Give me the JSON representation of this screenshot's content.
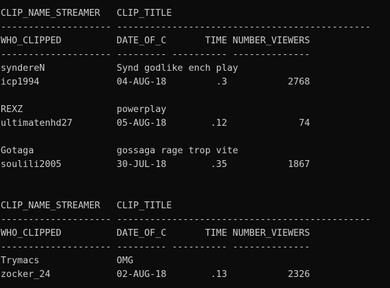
{
  "colors": {
    "background": "#0c0c0c",
    "text": "#cccccc"
  },
  "console": {
    "lines": [
      "CLIP_NAME_STREAMER   CLIP_TITLE",
      "-------------------- ----------------------------------------------",
      "WHO_CLIPPED          DATE_OF_C       TIME NUMBER_VIEWERS",
      "-------------------- --------- ---------- --------------",
      "syndereN             Synd godlike ench play",
      "icp1994              04-AUG-18         .3           2768",
      "",
      "REXZ                 powerplay",
      "ultimatenhd27        05-AUG-18        .12             74",
      "",
      "Gotaga               gossaga rage trop vite",
      "soulili2005          30-JUL-18        .35           1867",
      "",
      "",
      "CLIP_NAME_STREAMER   CLIP_TITLE",
      "-------------------- ----------------------------------------------",
      "WHO_CLIPPED          DATE_OF_C       TIME NUMBER_VIEWERS",
      "-------------------- --------- ---------- --------------",
      "Trymacs              OMG",
      "zocker_24            02-AUG-18        .13           2326"
    ]
  }
}
